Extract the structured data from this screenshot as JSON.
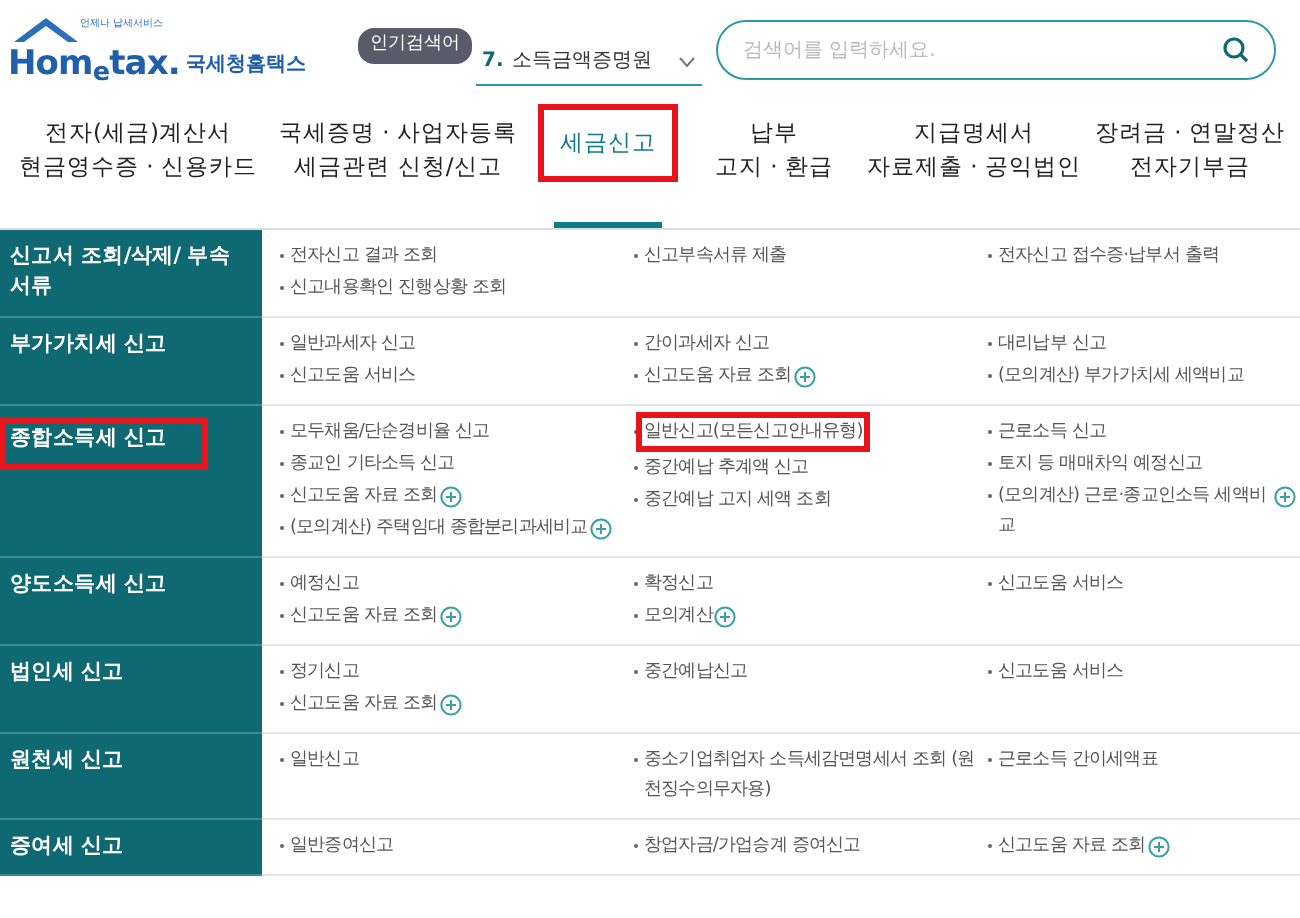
{
  "logo": {
    "tagline": "언제나 납세서비스",
    "wordmark": "Hom$_{e}$tax.",
    "name": "국세청홈택스"
  },
  "popular_search": {
    "badge": "인기검색어",
    "rank": "7.",
    "keyword": "소득금액증명원"
  },
  "search": {
    "placeholder": "검색어를 입력하세요."
  },
  "nav": [
    {
      "lines": [
        "전자(세금)계산서",
        "현금영수증 · 신용카드"
      ],
      "selected": false,
      "highlighted": false
    },
    {
      "lines": [
        "국세증명 · 사업자등록",
        "세금관련 신청/신고"
      ],
      "selected": false,
      "highlighted": false
    },
    {
      "lines": [
        "세금신고"
      ],
      "selected": true,
      "highlighted": true
    },
    {
      "lines": [
        "납부",
        "고지 · 환급"
      ],
      "selected": false,
      "highlighted": false
    },
    {
      "lines": [
        "지급명세서",
        "자료제출 · 공익법인"
      ],
      "selected": false,
      "highlighted": false
    },
    {
      "lines": [
        "장려금 · 연말정산",
        "전자기부금"
      ],
      "selected": false,
      "highlighted": false
    }
  ],
  "rows": [
    {
      "title": "신고서 조회/삭제/ 부속서류",
      "highlighted": false,
      "columns": [
        [
          {
            "text": "전자신고 결과 조회",
            "plus": false,
            "highlighted": false
          },
          {
            "text": "신고내용확인 진행상황 조회",
            "plus": false,
            "highlighted": false
          }
        ],
        [
          {
            "text": "신고부속서류 제출",
            "plus": false,
            "highlighted": false
          }
        ],
        [
          {
            "text": "전자신고 접수증·납부서 출력",
            "plus": false,
            "highlighted": false
          }
        ]
      ]
    },
    {
      "title": "부가가치세 신고",
      "highlighted": false,
      "columns": [
        [
          {
            "text": "일반과세자 신고",
            "plus": false,
            "highlighted": false
          },
          {
            "text": "신고도움 서비스",
            "plus": false,
            "highlighted": false
          }
        ],
        [
          {
            "text": "간이과세자 신고",
            "plus": false,
            "highlighted": false
          },
          {
            "text": "신고도움 자료 조회",
            "plus": true,
            "highlighted": false
          }
        ],
        [
          {
            "text": "대리납부 신고",
            "plus": false,
            "highlighted": false
          },
          {
            "text": "(모의계산) 부가가치세 세액비교",
            "plus": false,
            "highlighted": false
          }
        ]
      ]
    },
    {
      "title": "종합소득세 신고",
      "highlighted": true,
      "columns": [
        [
          {
            "text": "모두채움/단순경비율 신고",
            "plus": false,
            "highlighted": false
          },
          {
            "text": "종교인 기타소득 신고",
            "plus": false,
            "highlighted": false
          },
          {
            "text": "신고도움 자료 조회",
            "plus": true,
            "highlighted": false
          },
          {
            "text": "(모의계산) 주택임대 종합분리과세비교",
            "plus": true,
            "highlighted": false
          }
        ],
        [
          {
            "text": "일반신고(모든신고안내유형)",
            "plus": false,
            "highlighted": true
          },
          {
            "text": "중간예납 추계액 신고",
            "plus": false,
            "highlighted": false
          },
          {
            "text": "중간예납 고지 세액 조회",
            "plus": false,
            "highlighted": false
          }
        ],
        [
          {
            "text": "근로소득 신고",
            "plus": false,
            "highlighted": false
          },
          {
            "text": "토지 등 매매차익 예정신고",
            "plus": false,
            "highlighted": false
          },
          {
            "text": "(모의계산) 근로·종교인소득 세액비교",
            "plus": true,
            "highlighted": false
          }
        ]
      ]
    },
    {
      "title": "양도소득세 신고",
      "highlighted": false,
      "columns": [
        [
          {
            "text": "예정신고",
            "plus": false,
            "highlighted": false
          },
          {
            "text": "신고도움 자료 조회",
            "plus": true,
            "highlighted": false
          }
        ],
        [
          {
            "text": "확정신고",
            "plus": false,
            "highlighted": false
          },
          {
            "text": "모의계산",
            "plus": true,
            "highlighted": false
          }
        ],
        [
          {
            "text": "신고도움 서비스",
            "plus": false,
            "highlighted": false
          }
        ]
      ]
    },
    {
      "title": "법인세 신고",
      "highlighted": false,
      "columns": [
        [
          {
            "text": "정기신고",
            "plus": false,
            "highlighted": false
          },
          {
            "text": "신고도움 자료 조회",
            "plus": true,
            "highlighted": false
          }
        ],
        [
          {
            "text": "중간예납신고",
            "plus": false,
            "highlighted": false
          }
        ],
        [
          {
            "text": "신고도움 서비스",
            "plus": false,
            "highlighted": false
          }
        ]
      ]
    },
    {
      "title": "원천세 신고",
      "highlighted": false,
      "columns": [
        [
          {
            "text": "일반신고",
            "plus": false,
            "highlighted": false
          }
        ],
        [
          {
            "text": "중소기업취업자 소득세감면명세서 조회 (원천징수의무자용)",
            "plus": false,
            "highlighted": false
          }
        ],
        [
          {
            "text": "근로소득 간이세액표",
            "plus": false,
            "highlighted": false
          }
        ]
      ]
    },
    {
      "title": "증여세 신고",
      "highlighted": false,
      "columns": [
        [
          {
            "text": "일반증여신고",
            "plus": false,
            "highlighted": false
          }
        ],
        [
          {
            "text": "창업자금/가업승계 증여신고",
            "plus": false,
            "highlighted": false
          }
        ],
        [
          {
            "text": "신고도움 자료 조회",
            "plus": true,
            "highlighted": false
          }
        ]
      ]
    }
  ]
}
